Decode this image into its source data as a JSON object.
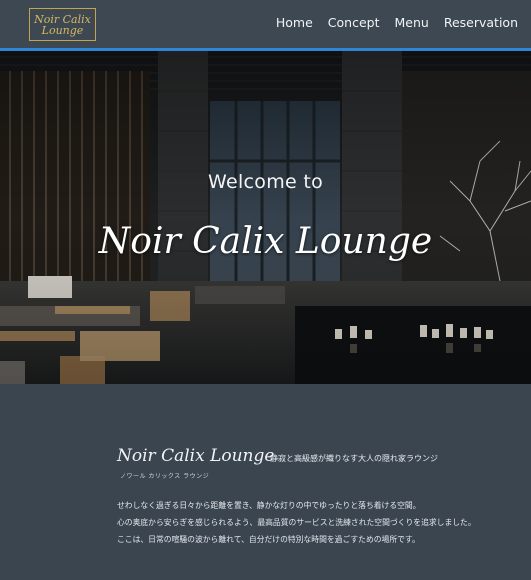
{
  "header": {
    "logo_line1": "Noir Calix",
    "logo_line2": "Lounge",
    "nav": [
      "Home",
      "Concept",
      "Menu",
      "Reservation"
    ]
  },
  "hero": {
    "welcome": "Welcome to",
    "title": "Noir Calix Lounge"
  },
  "about": {
    "brand": "Noir Calix Lounge",
    "kana": "ノワール カリックス ラウンジ",
    "tagline": "静寂と高級感が織りなす大人の隠れ家ラウンジ",
    "paragraphs": [
      "せわしなく過ぎる日々から距離を置き、静かな灯りの中でゆったりと落ち着ける空間。",
      "心の奥底から安らぎを感じられるよう、最高品質のサービスと洗練された空間づくりを追求しました。",
      "ここは、日常の喧騒の波から離れて、自分だけの特別な時間を過ごすための場所です。"
    ]
  },
  "colors": {
    "header_bg": "#3e4852",
    "accent_border": "#2f86d6",
    "logo_gold": "#d6b860",
    "section_bg": "#3b4550"
  }
}
